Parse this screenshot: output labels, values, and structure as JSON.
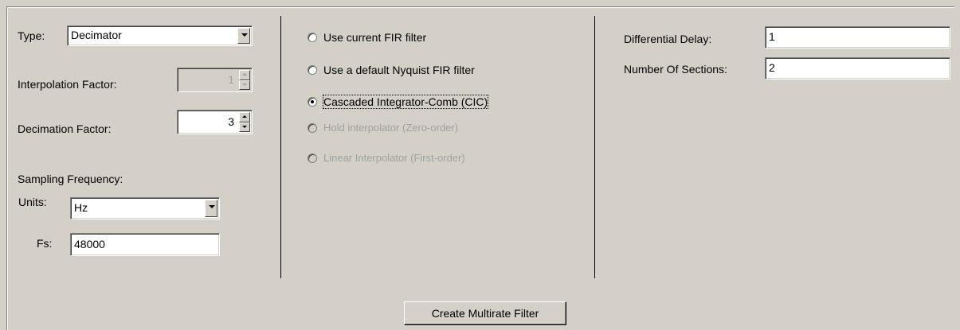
{
  "left": {
    "type_label": "Type:",
    "type_value": "Decimator",
    "interp_label": "Interpolation Factor:",
    "interp_value": "1",
    "decim_label": "Decimation Factor:",
    "decim_value": "3",
    "sampling_label": "Sampling Frequency:",
    "units_label": "Units:",
    "units_value": "Hz",
    "fs_label": "Fs:",
    "fs_value": "48000"
  },
  "middle": {
    "options": [
      {
        "label": "Use current FIR filter",
        "checked": false,
        "enabled": true
      },
      {
        "label": "Use a default Nyquist FIR filter",
        "checked": false,
        "enabled": true
      },
      {
        "label": "Cascaded Integrator-Comb (CIC)",
        "checked": true,
        "enabled": true
      },
      {
        "label": "Hold interpolator (Zero-order)",
        "checked": false,
        "enabled": false
      },
      {
        "label": "Linear Interpolator (First-order)",
        "checked": false,
        "enabled": false
      }
    ]
  },
  "right": {
    "delay_label": "Differential Delay:",
    "delay_value": "1",
    "sections_label": "Number Of Sections:",
    "sections_value": "2"
  },
  "action": {
    "create_label": "Create Multirate Filter"
  }
}
